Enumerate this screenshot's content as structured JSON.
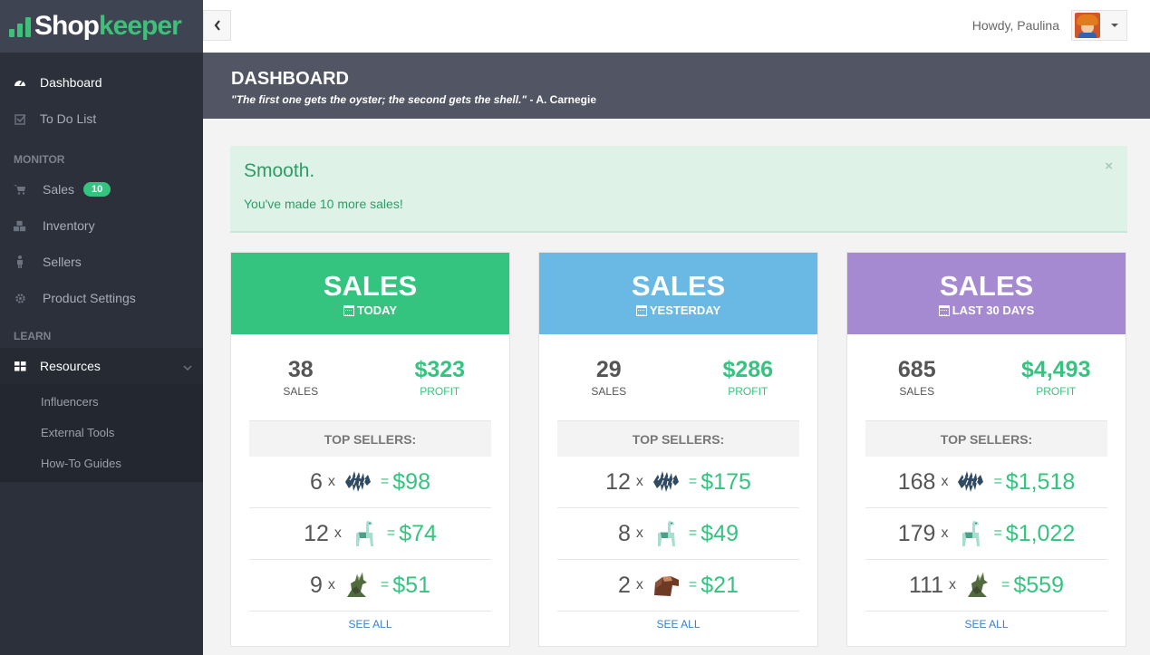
{
  "brand": {
    "part1": "Shop",
    "part2": "keeper"
  },
  "sidebar": {
    "items": [
      {
        "label": "Dashboard",
        "icon": "dashboard-icon"
      },
      {
        "label": "To Do List",
        "icon": "checkbox-icon"
      }
    ],
    "monitor_heading": "MONITOR",
    "monitor_items": [
      {
        "label": "Sales",
        "icon": "cart-icon",
        "badge": "10"
      },
      {
        "label": "Inventory",
        "icon": "cubes-icon"
      },
      {
        "label": "Sellers",
        "icon": "person-icon"
      },
      {
        "label": "Product Settings",
        "icon": "gear-icon"
      }
    ],
    "learn_heading": "LEARN",
    "resources": {
      "label": "Resources",
      "icon": "grid-icon"
    },
    "sub_items": [
      "Influencers",
      "External Tools",
      "How-To Guides"
    ]
  },
  "topbar": {
    "greeting": "Howdy, Paulina"
  },
  "header": {
    "title": "DASHBOARD",
    "quote": "\"The first one gets the oyster; the second gets the shell.\"",
    "author": " - A. Carnegie"
  },
  "alert": {
    "title": "Smooth.",
    "message": "You've made 10 more sales!",
    "close": "×"
  },
  "cards": [
    {
      "title": "SALES",
      "period": "TODAY",
      "color": "#35c47f",
      "sales": "38",
      "sales_label": "SALES",
      "profit": "$323",
      "profit_label": "PROFIT",
      "top_label": "TOP SELLERS:",
      "sellers": [
        {
          "qty": "6",
          "x": "x",
          "eq": "=",
          "amount": "$98",
          "product": "zebra-tie-icon"
        },
        {
          "qty": "12",
          "x": "x",
          "eq": "=",
          "amount": "$74",
          "product": "llama-icon"
        },
        {
          "qty": "9",
          "x": "x",
          "eq": "=",
          "amount": "$51",
          "product": "wolf-icon"
        }
      ],
      "see_all": "SEE ALL"
    },
    {
      "title": "SALES",
      "period": "YESTERDAY",
      "color": "#69b9e4",
      "sales": "29",
      "sales_label": "SALES",
      "profit": "$286",
      "profit_label": "PROFIT",
      "top_label": "TOP SELLERS:",
      "sellers": [
        {
          "qty": "12",
          "x": "x",
          "eq": "=",
          "amount": "$175",
          "product": "zebra-tie-icon"
        },
        {
          "qty": "8",
          "x": "x",
          "eq": "=",
          "amount": "$49",
          "product": "llama-icon"
        },
        {
          "qty": "2",
          "x": "x",
          "eq": "=",
          "amount": "$21",
          "product": "horse-icon"
        }
      ],
      "see_all": "SEE ALL"
    },
    {
      "title": "SALES",
      "period": "LAST 30 DAYS",
      "color": "#a58ad1",
      "sales": "685",
      "sales_label": "SALES",
      "profit": "$4,493",
      "profit_label": "PROFIT",
      "top_label": "TOP SELLERS:",
      "sellers": [
        {
          "qty": "168",
          "x": "x",
          "eq": "=",
          "amount": "$1,518",
          "product": "zebra-tie-icon"
        },
        {
          "qty": "179",
          "x": "x",
          "eq": "=",
          "amount": "$1,022",
          "product": "llama-icon"
        },
        {
          "qty": "111",
          "x": "x",
          "eq": "=",
          "amount": "$559",
          "product": "wolf-icon"
        }
      ],
      "see_all": "SEE ALL"
    }
  ]
}
